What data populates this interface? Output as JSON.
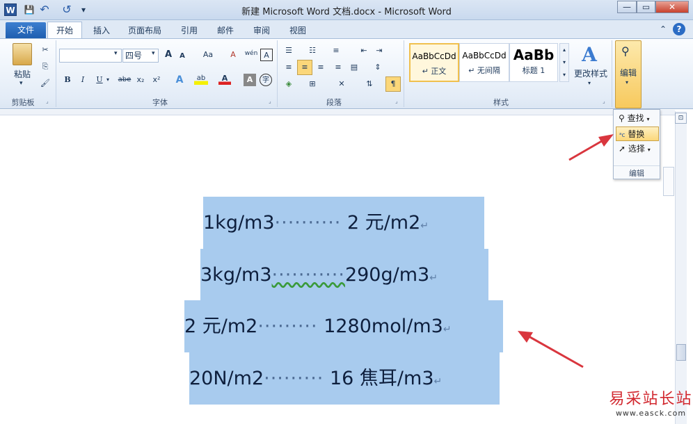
{
  "window": {
    "title": "新建 Microsoft Word 文档.docx - Microsoft Word",
    "app_icon": "W",
    "controls": {
      "minimize": "—",
      "maximize": "▭",
      "close": "✕"
    }
  },
  "quick_access": {
    "save_icon": "💾",
    "undo_icon": "↶",
    "redo_icon": "↺",
    "more_icon": "▾"
  },
  "tabs": [
    "文件",
    "开始",
    "插入",
    "页面布局",
    "引用",
    "邮件",
    "审阅",
    "视图"
  ],
  "tab_right": {
    "collapse": "⌃",
    "help": "?"
  },
  "ribbon": {
    "clipboard": {
      "label": "剪贴板",
      "paste": "粘贴",
      "cut_icon": "✂",
      "copy_icon": "⎘",
      "painter_icon": "🖌"
    },
    "font": {
      "label": "字体",
      "font_name": "",
      "font_size": "四号",
      "grow": "A",
      "shrink": "A",
      "change_case": "Aa",
      "clear": "A",
      "phonetic": "wén",
      "border": "A",
      "bold": "B",
      "italic": "I",
      "underline": "U",
      "strike": "abe",
      "sub": "x₂",
      "sup": "x²",
      "effects": "A",
      "highlight": "ab",
      "font_color": "A",
      "shading": "A",
      "enclose": "字"
    },
    "paragraph": {
      "label": "段落"
    },
    "styles": {
      "label": "样式",
      "items": [
        {
          "sample": "AaBbCcDd",
          "name": "↵ 正文"
        },
        {
          "sample": "AaBbCcDd",
          "name": "↵ 无间隔"
        },
        {
          "sample": "AaBb",
          "name": "标题 1"
        }
      ],
      "change_styles": "更改样式"
    },
    "editing": {
      "label": "编辑",
      "button": "编辑",
      "popup": {
        "find": "查找",
        "replace": "替换",
        "select": "选择",
        "group_label": "编辑"
      }
    }
  },
  "document": {
    "lines": [
      {
        "left": "1kg/m3",
        "dots": "··········",
        "right": "2 元/m2",
        "mark": "↵"
      },
      {
        "left": "3kg/m3",
        "dots": "···········",
        "right": "290g/m3",
        "mark": "↵"
      },
      {
        "left": "2 元/m2",
        "dots": "·········",
        "right": "1280mol/m3",
        "mark": "↵"
      },
      {
        "left": "20N/m2",
        "dots": "·········",
        "right": "16 焦耳/m3",
        "mark": "↵"
      }
    ]
  },
  "watermark": {
    "name": "易采站长站",
    "url": "www.easck.com"
  },
  "colors": {
    "selection": "#a8cbee",
    "arrow": "#d9363e",
    "file_tab": "#2b5fa8"
  }
}
